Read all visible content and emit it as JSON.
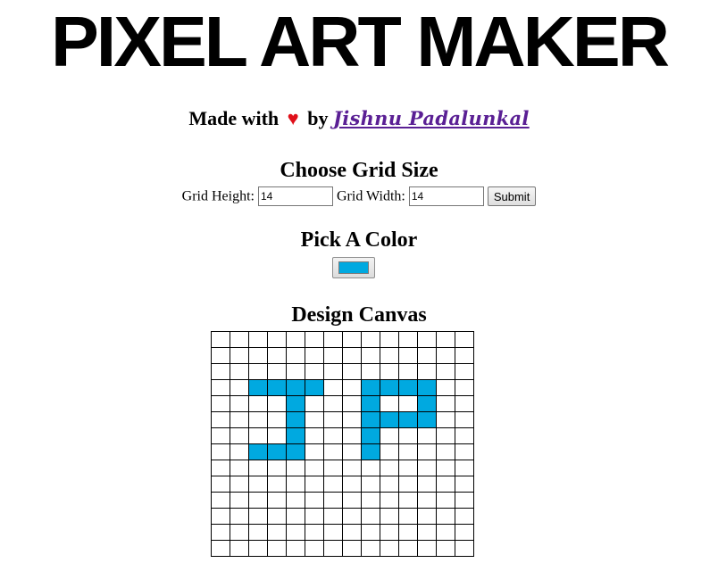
{
  "header": {
    "logo_text": "PIXEL ART MAKER"
  },
  "credit": {
    "prefix": "Made with",
    "heart": "♥",
    "by": "by",
    "author": "Jishnu Padalunkal"
  },
  "grid_size": {
    "title": "Choose Grid Size",
    "height_label": "Grid Height:",
    "height_value": "14",
    "width_label": "Grid Width:",
    "width_value": "14",
    "submit_label": "Submit"
  },
  "color": {
    "title": "Pick A Color",
    "value": "#00a9e0"
  },
  "canvas": {
    "title": "Design Canvas",
    "rows": 14,
    "cols": 14,
    "fill_color": "#00a9e0",
    "filled_cells": [
      [
        3,
        2
      ],
      [
        3,
        3
      ],
      [
        3,
        4
      ],
      [
        3,
        5
      ],
      [
        3,
        8
      ],
      [
        3,
        9
      ],
      [
        3,
        10
      ],
      [
        3,
        11
      ],
      [
        4,
        4
      ],
      [
        4,
        8
      ],
      [
        4,
        11
      ],
      [
        5,
        4
      ],
      [
        5,
        8
      ],
      [
        5,
        9
      ],
      [
        5,
        10
      ],
      [
        5,
        11
      ],
      [
        6,
        4
      ],
      [
        6,
        8
      ],
      [
        7,
        2
      ],
      [
        7,
        3
      ],
      [
        7,
        4
      ],
      [
        7,
        8
      ]
    ]
  }
}
